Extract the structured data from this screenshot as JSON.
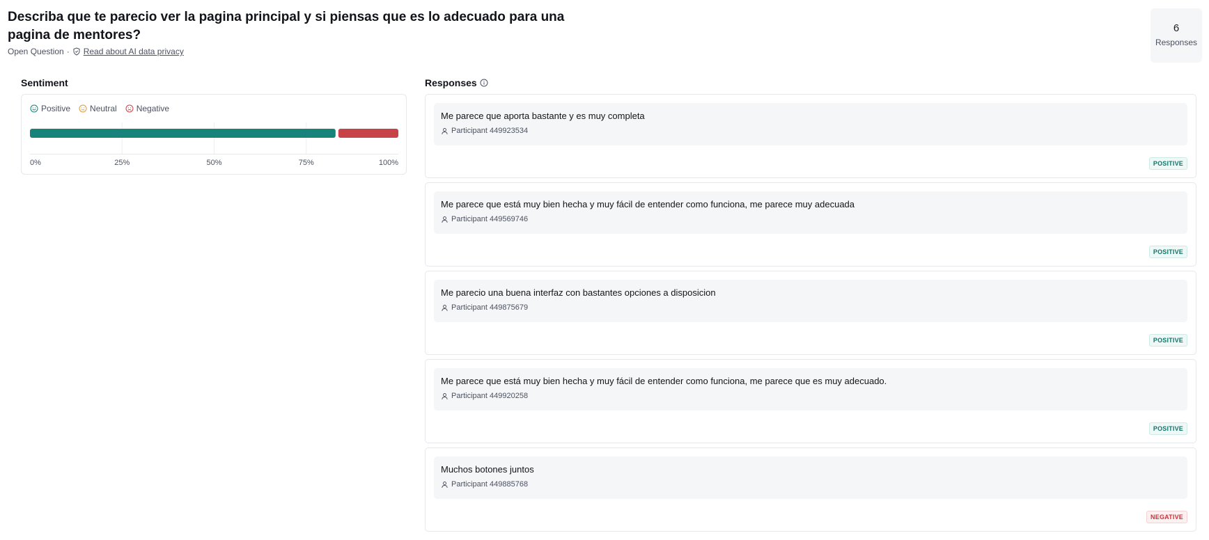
{
  "question": {
    "title": "Describa que te parecio ver la pagina principal y si piensas que es lo adecuado para una pagina de mentores?",
    "type": "Open Question",
    "separator": "·",
    "privacy_link": "Read about AI data privacy"
  },
  "summary": {
    "count": "6",
    "label": "Responses"
  },
  "sentiment": {
    "title": "Sentiment",
    "legend": [
      {
        "label": "Positive",
        "color": "#13827a",
        "icon": "smile-icon"
      },
      {
        "label": "Neutral",
        "color": "#d99a3c",
        "icon": "neutral-face-icon"
      },
      {
        "label": "Negative",
        "color": "#c8424a",
        "icon": "frown-icon"
      }
    ]
  },
  "chart_data": {
    "type": "bar",
    "orientation": "horizontal-stacked",
    "series": [
      {
        "name": "Positive",
        "value": 83.33,
        "color": "#17837a"
      },
      {
        "name": "Neutral",
        "value": 0,
        "color": "#d99a3c"
      },
      {
        "name": "Negative",
        "value": 16.67,
        "color": "#c8424a"
      }
    ],
    "xlim": [
      0,
      100
    ],
    "ticks": [
      "0%",
      "25%",
      "50%",
      "75%",
      "100%"
    ],
    "grid": true
  },
  "responses": {
    "title": "Responses",
    "items": [
      {
        "text": "Me parece que aporta bastante y es muy completa",
        "participant": "Participant 449923534",
        "sentiment": "POSITIVE"
      },
      {
        "text": "Me parece que está muy bien hecha y muy fácil de entender como funciona, me parece muy adecuada",
        "participant": "Participant 449569746",
        "sentiment": "POSITIVE"
      },
      {
        "text": "Me parecio una buena interfaz con bastantes opciones a disposicion",
        "participant": "Participant 449875679",
        "sentiment": "POSITIVE"
      },
      {
        "text": "Me parece que está muy bien hecha y muy fácil de entender como funciona, me parece que es muy adecuado.",
        "participant": "Participant 449920258",
        "sentiment": "POSITIVE"
      },
      {
        "text": "Muchos botones juntos",
        "participant": "Participant 449885768",
        "sentiment": "NEGATIVE"
      }
    ]
  }
}
